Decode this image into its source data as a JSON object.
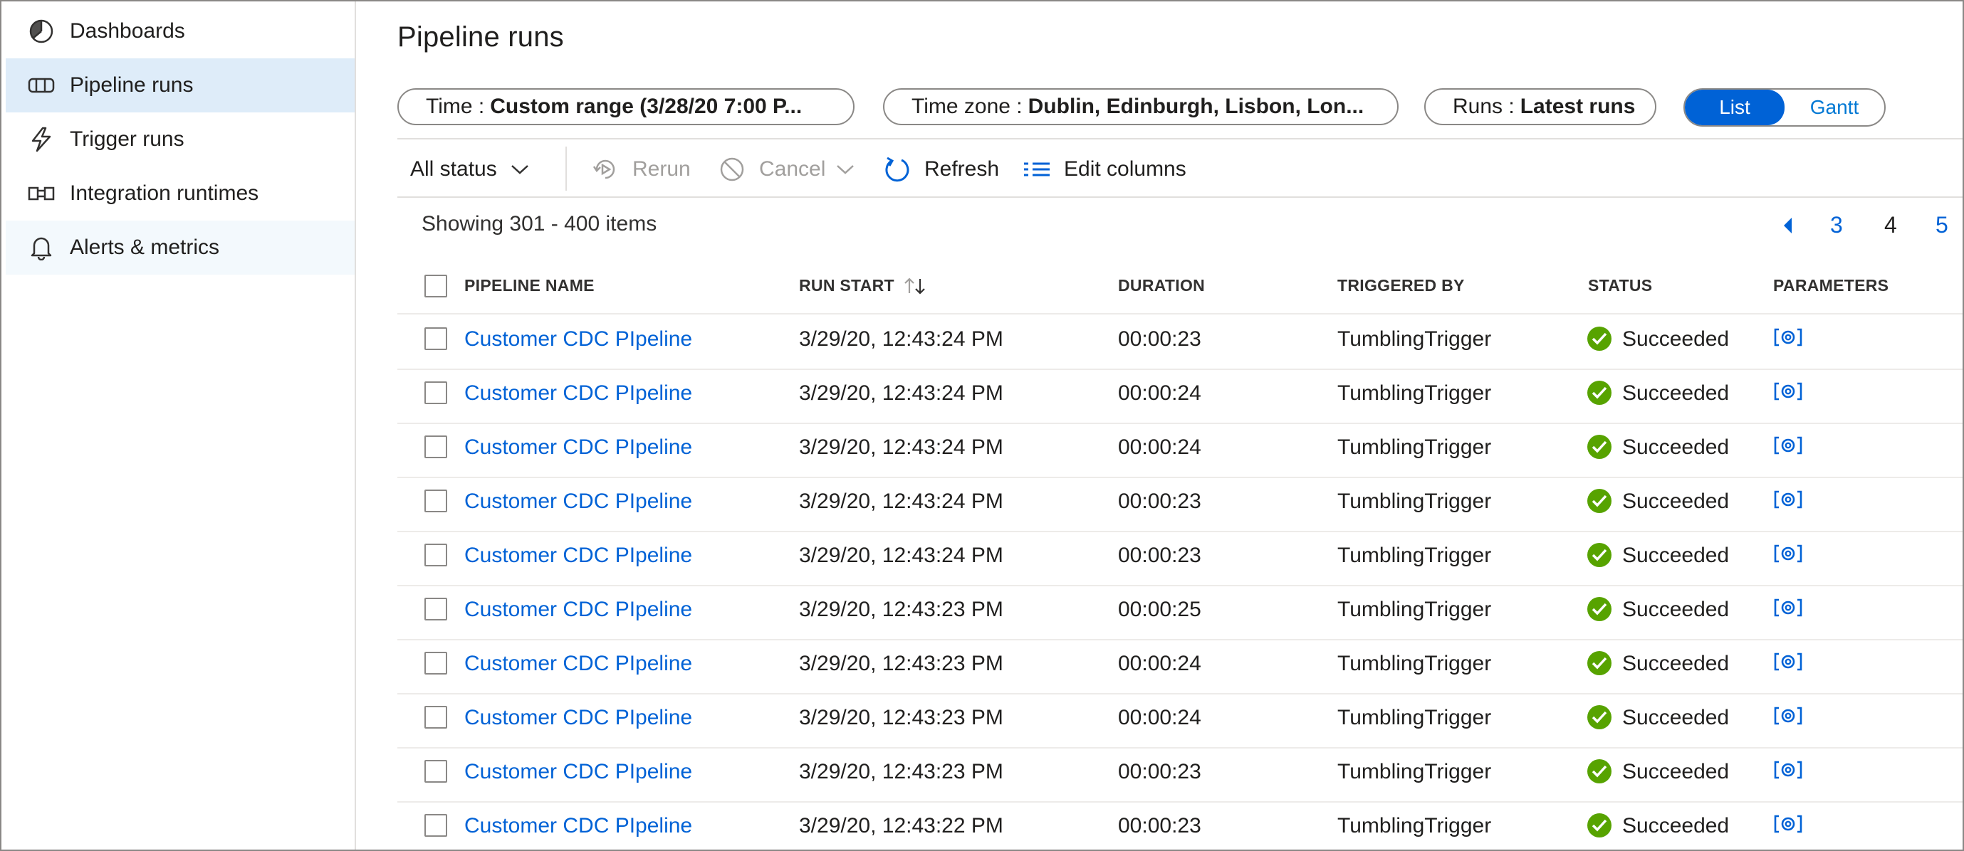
{
  "sidebar": {
    "items": [
      {
        "label": "Dashboards",
        "icon": "dashboard-icon"
      },
      {
        "label": "Pipeline runs",
        "icon": "pipeline-icon"
      },
      {
        "label": "Trigger runs",
        "icon": "lightning-icon"
      },
      {
        "label": "Integration runtimes",
        "icon": "integration-runtime-icon"
      },
      {
        "label": "Alerts & metrics",
        "icon": "bell-icon"
      }
    ]
  },
  "page": {
    "title": "Pipeline runs"
  },
  "filters": {
    "time": {
      "label": "Time :",
      "value": "Custom range (3/28/20 7:00 P..."
    },
    "timezone": {
      "label": "Time zone :",
      "value": "Dublin, Edinburgh, Lisbon, Lon..."
    },
    "runs": {
      "label": "Runs :",
      "value": "Latest runs"
    }
  },
  "view_toggle": {
    "options": [
      "List",
      "Gantt"
    ],
    "selected": "List"
  },
  "toolbar": {
    "status_filter": "All status",
    "rerun": "Rerun",
    "cancel": "Cancel",
    "refresh": "Refresh",
    "edit_columns": "Edit columns"
  },
  "showing": "Showing 301 - 400 items",
  "pagination": {
    "pages": [
      "3",
      "4",
      "5"
    ],
    "current": "4"
  },
  "table": {
    "columns": [
      "PIPELINE NAME",
      "RUN START",
      "DURATION",
      "TRIGGERED BY",
      "STATUS",
      "PARAMETERS"
    ],
    "rows": [
      {
        "name": "Customer CDC PIpeline",
        "run_start": "3/29/20, 12:43:24 PM",
        "duration": "00:00:23",
        "triggered_by": "TumblingTrigger",
        "status": "Succeeded"
      },
      {
        "name": "Customer CDC PIpeline",
        "run_start": "3/29/20, 12:43:24 PM",
        "duration": "00:00:24",
        "triggered_by": "TumblingTrigger",
        "status": "Succeeded"
      },
      {
        "name": "Customer CDC PIpeline",
        "run_start": "3/29/20, 12:43:24 PM",
        "duration": "00:00:24",
        "triggered_by": "TumblingTrigger",
        "status": "Succeeded"
      },
      {
        "name": "Customer CDC PIpeline",
        "run_start": "3/29/20, 12:43:24 PM",
        "duration": "00:00:23",
        "triggered_by": "TumblingTrigger",
        "status": "Succeeded"
      },
      {
        "name": "Customer CDC PIpeline",
        "run_start": "3/29/20, 12:43:24 PM",
        "duration": "00:00:23",
        "triggered_by": "TumblingTrigger",
        "status": "Succeeded"
      },
      {
        "name": "Customer CDC PIpeline",
        "run_start": "3/29/20, 12:43:23 PM",
        "duration": "00:00:25",
        "triggered_by": "TumblingTrigger",
        "status": "Succeeded"
      },
      {
        "name": "Customer CDC PIpeline",
        "run_start": "3/29/20, 12:43:23 PM",
        "duration": "00:00:24",
        "triggered_by": "TumblingTrigger",
        "status": "Succeeded"
      },
      {
        "name": "Customer CDC PIpeline",
        "run_start": "3/29/20, 12:43:23 PM",
        "duration": "00:00:24",
        "triggered_by": "TumblingTrigger",
        "status": "Succeeded"
      },
      {
        "name": "Customer CDC PIpeline",
        "run_start": "3/29/20, 12:43:23 PM",
        "duration": "00:00:23",
        "triggered_by": "TumblingTrigger",
        "status": "Succeeded"
      },
      {
        "name": "Customer CDC PIpeline",
        "run_start": "3/29/20, 12:43:22 PM",
        "duration": "00:00:23",
        "triggered_by": "TumblingTrigger",
        "status": "Succeeded"
      }
    ]
  },
  "colors": {
    "accent": "#0062d6",
    "success": "#57a300",
    "selected_nav": "#deecf9"
  }
}
